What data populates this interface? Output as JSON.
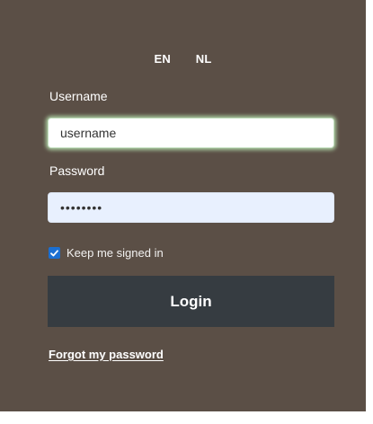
{
  "language_switch": {
    "options": [
      "EN",
      "NL"
    ]
  },
  "login_form": {
    "username": {
      "label": "Username",
      "value": "username"
    },
    "password": {
      "label": "Password",
      "value": "••••••••",
      "masked_length": 8
    },
    "remember_me": {
      "label": "Keep me signed in",
      "checked": true,
      "icon": "checkmark-icon"
    },
    "submit_label": "Login",
    "forgot_password_label": "Forgot my password"
  },
  "colors": {
    "panel_background": "#5b4f46",
    "button_background": "#363c41",
    "focus_glow": "#b8e2b0",
    "autofill_background": "#e8f0fe",
    "checkbox_accent": "#1b6fd2",
    "text": "#ffffff"
  }
}
